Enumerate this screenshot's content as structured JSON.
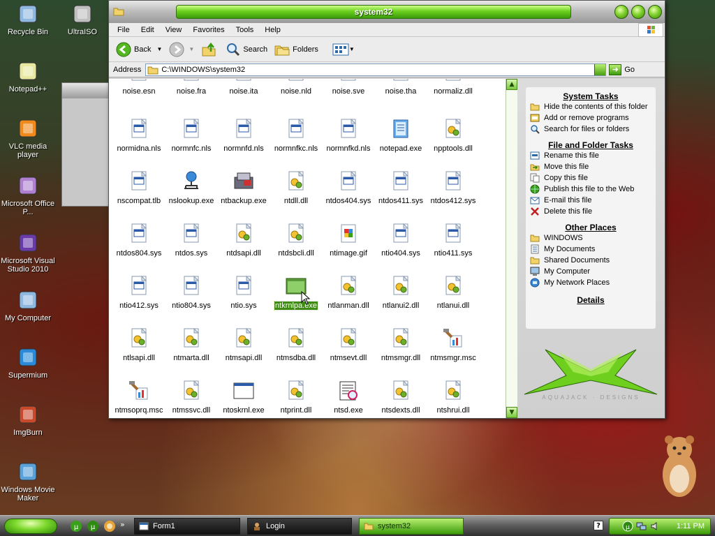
{
  "desktop": {
    "icons": [
      {
        "label": "Recycle Bin",
        "icon": "recycle-bin-icon"
      },
      {
        "label": "UltraISO",
        "icon": "disc-icon"
      },
      {
        "label": "Notepad++",
        "icon": "notepad-plus-icon"
      },
      {
        "label": "VLC media player",
        "icon": "vlc-cone-icon"
      },
      {
        "label": "Microsoft Office P...",
        "icon": "office-icon"
      },
      {
        "label": "Microsoft Visual Studio 2010",
        "icon": "visual-studio-icon"
      },
      {
        "label": "My Computer",
        "icon": "computer-icon"
      },
      {
        "label": "Supermium",
        "icon": "browser-icon"
      },
      {
        "label": "ImgBurn",
        "icon": "disc-burn-icon"
      },
      {
        "label": "Windows Movie Maker",
        "icon": "movie-maker-icon"
      }
    ]
  },
  "window": {
    "title": "system32",
    "menu": [
      "File",
      "Edit",
      "View",
      "Favorites",
      "Tools",
      "Help"
    ],
    "toolbar": {
      "back": "Back",
      "search": "Search",
      "folders": "Folders"
    },
    "address": {
      "label": "Address",
      "value": "C:\\WINDOWS\\system32",
      "go": "Go"
    }
  },
  "files": [
    {
      "name": "noise.esn",
      "icon": "sys"
    },
    {
      "name": "noise.fra",
      "icon": "sys"
    },
    {
      "name": "noise.ita",
      "icon": "sys"
    },
    {
      "name": "noise.nld",
      "icon": "sys"
    },
    {
      "name": "noise.sve",
      "icon": "sys"
    },
    {
      "name": "noise.tha",
      "icon": "sys"
    },
    {
      "name": "normaliz.dll",
      "icon": "dll"
    },
    {
      "name": "normidna.nls",
      "icon": "sys"
    },
    {
      "name": "normnfc.nls",
      "icon": "sys"
    },
    {
      "name": "normnfd.nls",
      "icon": "sys"
    },
    {
      "name": "normnfkc.nls",
      "icon": "sys"
    },
    {
      "name": "normnfkd.nls",
      "icon": "sys"
    },
    {
      "name": "notepad.exe",
      "icon": "notepad"
    },
    {
      "name": "npptools.dll",
      "icon": "dll"
    },
    {
      "name": "nscompat.tlb",
      "icon": "sys"
    },
    {
      "name": "nslookup.exe",
      "icon": "network"
    },
    {
      "name": "ntbackup.exe",
      "icon": "backup"
    },
    {
      "name": "ntdll.dll",
      "icon": "dll"
    },
    {
      "name": "ntdos404.sys",
      "icon": "sys"
    },
    {
      "name": "ntdos411.sys",
      "icon": "sys"
    },
    {
      "name": "ntdos412.sys",
      "icon": "sys"
    },
    {
      "name": "ntdos804.sys",
      "icon": "sys"
    },
    {
      "name": "ntdos.sys",
      "icon": "sys"
    },
    {
      "name": "ntdsapi.dll",
      "icon": "dll"
    },
    {
      "name": "ntdsbcli.dll",
      "icon": "dll"
    },
    {
      "name": "ntimage.gif",
      "icon": "image"
    },
    {
      "name": "ntio404.sys",
      "icon": "sys"
    },
    {
      "name": "ntio411.sys",
      "icon": "sys"
    },
    {
      "name": "ntio412.sys",
      "icon": "sys"
    },
    {
      "name": "ntio804.sys",
      "icon": "sys"
    },
    {
      "name": "ntio.sys",
      "icon": "sys"
    },
    {
      "name": "ntkrnlpa.exe",
      "icon": "exe"
    },
    {
      "name": "ntlanman.dll",
      "icon": "dll"
    },
    {
      "name": "ntlanui2.dll",
      "icon": "dll"
    },
    {
      "name": "ntlanui.dll",
      "icon": "dll"
    },
    {
      "name": "ntlsapi.dll",
      "icon": "dll"
    },
    {
      "name": "ntmarta.dll",
      "icon": "dll"
    },
    {
      "name": "ntmsapi.dll",
      "icon": "dll"
    },
    {
      "name": "ntmsdba.dll",
      "icon": "dll"
    },
    {
      "name": "ntmsevt.dll",
      "icon": "dll"
    },
    {
      "name": "ntmsmgr.dll",
      "icon": "dll"
    },
    {
      "name": "ntmsmgr.msc",
      "icon": "msc"
    },
    {
      "name": "ntmsoprq.msc",
      "icon": "msc"
    },
    {
      "name": "ntmssvc.dll",
      "icon": "dll"
    },
    {
      "name": "ntoskrnl.exe",
      "icon": "exe-white"
    },
    {
      "name": "ntprint.dll",
      "icon": "dll"
    },
    {
      "name": "ntsd.exe",
      "icon": "debug"
    },
    {
      "name": "ntsdexts.dll",
      "icon": "dll"
    },
    {
      "name": "ntshrui.dll",
      "icon": "dll"
    }
  ],
  "selected_file": "ntkrnlpa.exe",
  "taskpane": {
    "system_tasks": {
      "title": "System Tasks",
      "items": [
        {
          "label": "Hide the contents of this folder",
          "icon": "folder-hide-icon"
        },
        {
          "label": "Add or remove programs",
          "icon": "add-remove-icon"
        },
        {
          "label": "Search for files or folders",
          "icon": "search-icon"
        }
      ]
    },
    "file_tasks": {
      "title": "File and Folder Tasks",
      "items": [
        {
          "label": "Rename this file",
          "icon": "rename-icon"
        },
        {
          "label": "Move this file",
          "icon": "move-icon"
        },
        {
          "label": "Copy this file",
          "icon": "copy-icon"
        },
        {
          "label": "Publish this file to the Web",
          "icon": "globe-icon"
        },
        {
          "label": "E-mail this file",
          "icon": "email-icon"
        },
        {
          "label": "Delete this file",
          "icon": "delete-icon"
        }
      ]
    },
    "other_places": {
      "title": "Other Places",
      "items": [
        {
          "label": "WINDOWS",
          "icon": "folder-icon"
        },
        {
          "label": "My Documents",
          "icon": "documents-icon"
        },
        {
          "label": "Shared Documents",
          "icon": "folder-icon"
        },
        {
          "label": "My Computer",
          "icon": "computer-icon"
        },
        {
          "label": "My Network Places",
          "icon": "network-icon"
        }
      ]
    },
    "details": {
      "title": "Details"
    },
    "logo_text": "AQUAJACK · DESIGNS"
  },
  "taskbar": {
    "tasks": [
      {
        "label": "Form1",
        "active": false
      },
      {
        "label": "Login",
        "active": false
      },
      {
        "label": "system32",
        "active": true
      }
    ],
    "help": "?",
    "clock": "1:11 PM"
  },
  "colors": {
    "accent_green": "#3b9a0a",
    "selection": "#3e8d12"
  }
}
